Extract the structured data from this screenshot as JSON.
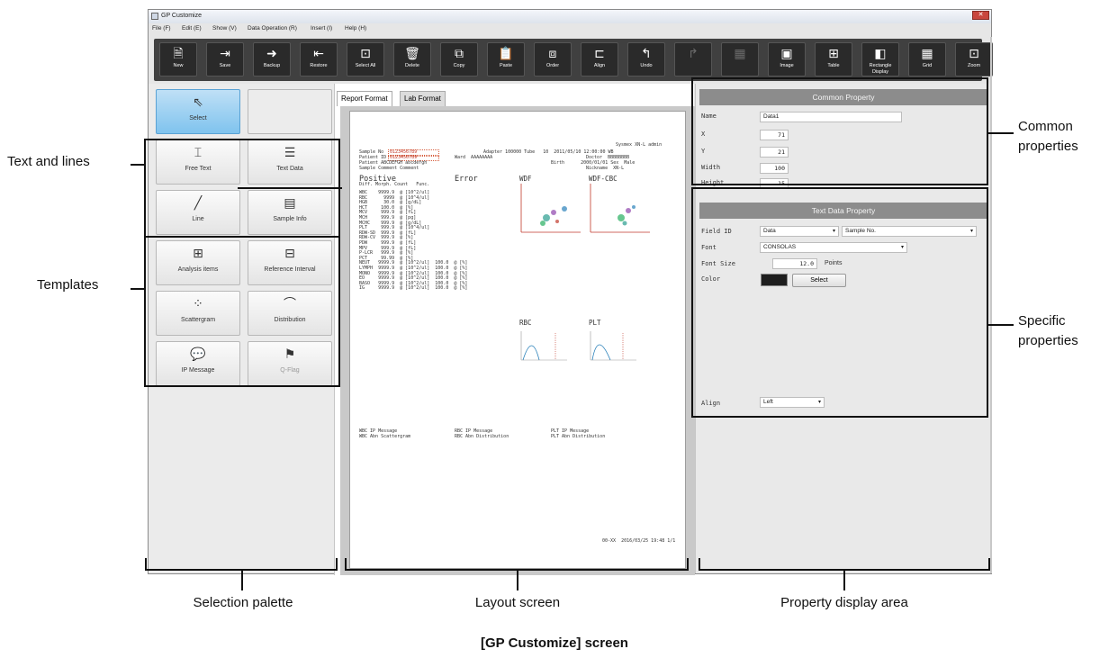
{
  "window": {
    "title": "GP Customize",
    "close_glyph": "✕"
  },
  "menu": [
    "File (F)",
    "Edit (E)",
    "Show (V)",
    "Data Operation (R)",
    "Insert (I)",
    "Help (H)"
  ],
  "toolbar": [
    {
      "label": "New",
      "icon": "new-doc-icon",
      "glyph": "🗎"
    },
    {
      "label": "Save",
      "icon": "save-icon",
      "glyph": "⇥"
    },
    {
      "label": "Backup",
      "icon": "backup-icon",
      "glyph": "➜"
    },
    {
      "label": "Restore",
      "icon": "restore-icon",
      "glyph": "⇤"
    },
    {
      "label": "Select All",
      "icon": "select-all-icon",
      "glyph": "⊡"
    },
    {
      "label": "Delete",
      "icon": "delete-icon",
      "glyph": "🗑"
    },
    {
      "label": "Copy",
      "icon": "copy-icon",
      "glyph": "⧉"
    },
    {
      "label": "Paste",
      "icon": "paste-icon",
      "glyph": "📋"
    },
    {
      "label": "Order",
      "icon": "order-icon",
      "glyph": "⧈"
    },
    {
      "label": "Align",
      "icon": "align-icon",
      "glyph": "⊏"
    },
    {
      "label": "Undo",
      "icon": "undo-icon",
      "glyph": "↰"
    },
    {
      "label": "",
      "icon": "redo-icon",
      "glyph": "↱"
    },
    {
      "label": "",
      "icon": "group-icon",
      "glyph": "▦"
    },
    {
      "label": "Image",
      "icon": "image-icon",
      "glyph": "▣"
    },
    {
      "label": "Table",
      "icon": "table-icon",
      "glyph": "⊞"
    },
    {
      "label": "Rectangle Display",
      "icon": "rectangle-display-icon",
      "glyph": "◧"
    },
    {
      "label": "Grid",
      "icon": "grid-icon",
      "glyph": "▦"
    },
    {
      "label": "Zoom",
      "icon": "zoom-icon",
      "glyph": "⊡"
    }
  ],
  "palette": [
    {
      "label": "Select",
      "icon": "cursor-icon",
      "glyph": "⇖",
      "state": "selected"
    },
    {
      "label": "",
      "icon": "",
      "glyph": "",
      "state": "empty"
    },
    {
      "label": "Free Text",
      "icon": "free-text-icon",
      "glyph": "⌶",
      "state": "normal"
    },
    {
      "label": "Text Data",
      "icon": "text-data-icon",
      "glyph": "☰",
      "state": "normal"
    },
    {
      "label": "Line",
      "icon": "line-icon",
      "glyph": "╱",
      "state": "normal"
    },
    {
      "label": "Sample Info",
      "icon": "sample-info-icon",
      "glyph": "▤",
      "state": "normal"
    },
    {
      "label": "Analysis items",
      "icon": "analysis-items-icon",
      "glyph": "⊞",
      "state": "normal"
    },
    {
      "label": "Reference Interval",
      "icon": "reference-interval-icon",
      "glyph": "⊟",
      "state": "normal"
    },
    {
      "label": "Scattergram",
      "icon": "scattergram-icon",
      "glyph": "⁘",
      "state": "normal"
    },
    {
      "label": "Distribution",
      "icon": "distribution-icon",
      "glyph": "⌒",
      "state": "normal"
    },
    {
      "label": "IP Message",
      "icon": "ip-message-icon",
      "glyph": "💬",
      "state": "normal"
    },
    {
      "label": "Q-Flag",
      "icon": "q-flag-icon",
      "glyph": "⚑",
      "state": "dim"
    }
  ],
  "tabs": [
    "Report Format",
    "Lab Format"
  ],
  "report": {
    "header_right": "Sysmex XN-L admin",
    "sample_no_label": "Sample No",
    "sample_no": "0123456789",
    "patient_id_label": "Patient ID",
    "patient_id": "0123456789",
    "adapter": "Adapter 100000 Tube   10  2011/05/10 12:00:00 WB",
    "ward": "Ward  AAAAAAAA",
    "doctor": "Doctor  BBBBBBBB",
    "patient_name": "Patient ABCDEFGH abcdefgh",
    "birth": "Birth      2000/01/01 Sex  Male",
    "sample_comment": "Sample Comment Comment",
    "nickname": "Nickname  XN-L",
    "positive": "Positive",
    "error": "Error",
    "wdf": "WDF",
    "wdf_cbc": "WDF-CBC",
    "diff_line": "Diff. Morph. Count   Func.",
    "lab_values": "WBC    9999.9  @ [10^2/ul]\nRBC      9999  @ [10^4/ul]\nHGB      30.0  @ [g/dL]\nHCT     100.0  @ [%]\nMCV     999.9  @ [fL]\nMCH     999.9  @ [pg]\nMCHC    999.9  @ [g/dL]\nPLT     999.9  @ [10^4/ul]\nRDW-SD  999.9  @ [fL]\nRDW-CV  999.9  @ [%]\nPDW     999.9  @ [fL]\nMPV     999.9  @ [fL]\nP-LCR   999.9  @ [%]\nPCT     99.99  @ [%]\nNEUT   9999.9  @ [10^2/ul]  100.0  @ [%]\nLYMPH  9999.9  @ [10^2/ul]  100.0  @ [%]\nMONO   9999.9  @ [10^2/ul]  100.0  @ [%]\nEO     9999.9  @ [10^2/ul]  100.0  @ [%]\nBASO   9999.9  @ [10^2/ul]  100.0  @ [%]\nIG     9999.9  @ [10^2/ul]  100.0  @ [%]",
    "rbc": "RBC",
    "plt": "PLT",
    "wbc_ip": "WBC IP Message\nWBC Abn Scattergram",
    "rbc_ip": "RBC IP Message\nRBC Abn Distribution",
    "plt_ip": "PLT IP Message\nPLT Abn Distribution",
    "footer": "00-XX  2016/03/25 19:48 1/1"
  },
  "common_property": {
    "title": "Common Property",
    "fields": [
      {
        "label": "Name",
        "value": "Data1"
      },
      {
        "label": "X",
        "value": "71"
      },
      {
        "label": "Y",
        "value": "21"
      },
      {
        "label": "Width",
        "value": "100"
      },
      {
        "label": "Height",
        "value": "15"
      }
    ]
  },
  "text_data_property": {
    "title": "Text Data Property",
    "field_id_label": "Field ID",
    "field_id_value1": "Data",
    "field_id_value2": "Sample No.",
    "font_label": "Font",
    "font_value": "CONSOLAS",
    "font_size_label": "Font Size",
    "font_size_value": "12.0",
    "font_size_unit": "Points",
    "color_label": "Color",
    "color_value": "#1e1e1e",
    "color_button": "Select",
    "align_label": "Align",
    "align_value": "Left"
  },
  "annotations": {
    "text_and_lines": "Text and lines",
    "templates": "Templates",
    "common_properties": "Common\nproperties",
    "specific_properties": "Specific\nproperties",
    "selection_palette": "Selection palette",
    "layout_screen": "Layout screen",
    "property_display_area": "Property display area",
    "caption": "[GP Customize] screen"
  }
}
